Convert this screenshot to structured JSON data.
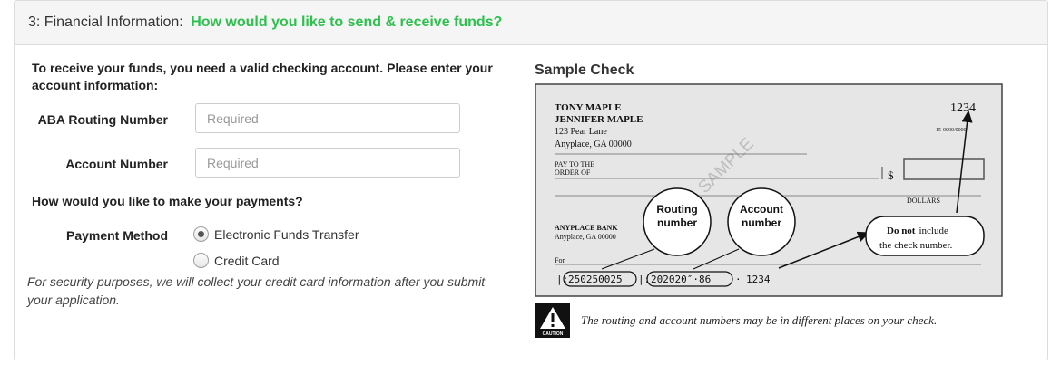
{
  "header": {
    "step_prefix": "3: Financial Information: ",
    "question": "How would you like to send & receive funds?"
  },
  "intro": "To receive your funds, you need a valid checking account. Please enter your account information:",
  "fields": {
    "routing": {
      "label": "ABA Routing Number",
      "placeholder": "Required",
      "value": ""
    },
    "account": {
      "label": "Account Number",
      "placeholder": "Required",
      "value": ""
    }
  },
  "payments_question": "How would you like to make your payments?",
  "payment_method": {
    "label": "Payment Method",
    "options": [
      {
        "label": "Electronic Funds Transfer",
        "selected": true
      },
      {
        "label": "Credit Card",
        "selected": false
      }
    ]
  },
  "security_note": "For security purposes, we will collect your credit card information after you submit your application.",
  "sample_check": {
    "title": "Sample Check",
    "name1": "TONY MAPLE",
    "name2": "JENNIFER MAPLE",
    "address1": "123 Pear Lane",
    "address2": "Anyplace, GA 00000",
    "check_number": "1234",
    "fraction_code": "15-0000/0000",
    "watermark": "SAMPLE",
    "pay_to_line1": "PAY TO THE",
    "pay_to_line2": "ORDER OF",
    "dollar_sign": "$",
    "dollars": "DOLLARS",
    "bank_name": "ANYPLACE BANK",
    "bank_address": "Anyplace, GA 00000",
    "for_label": "For",
    "routing_callout_line1": "Routing",
    "routing_callout_line2": "number",
    "account_callout_line1": "Account",
    "account_callout_line2": "number",
    "note_bold": "Do not",
    "note_rest": "include",
    "note_line2": "the check number.",
    "micr_routing": "250250025",
    "micr_account": "202020″·86",
    "micr_check": "1234",
    "caution_label": "CAUTION",
    "caution_text": "The routing and account numbers may be in different places on your check."
  },
  "colors": {
    "accent_green": "#2fbf4f",
    "check_background": "#e6e6e6"
  }
}
